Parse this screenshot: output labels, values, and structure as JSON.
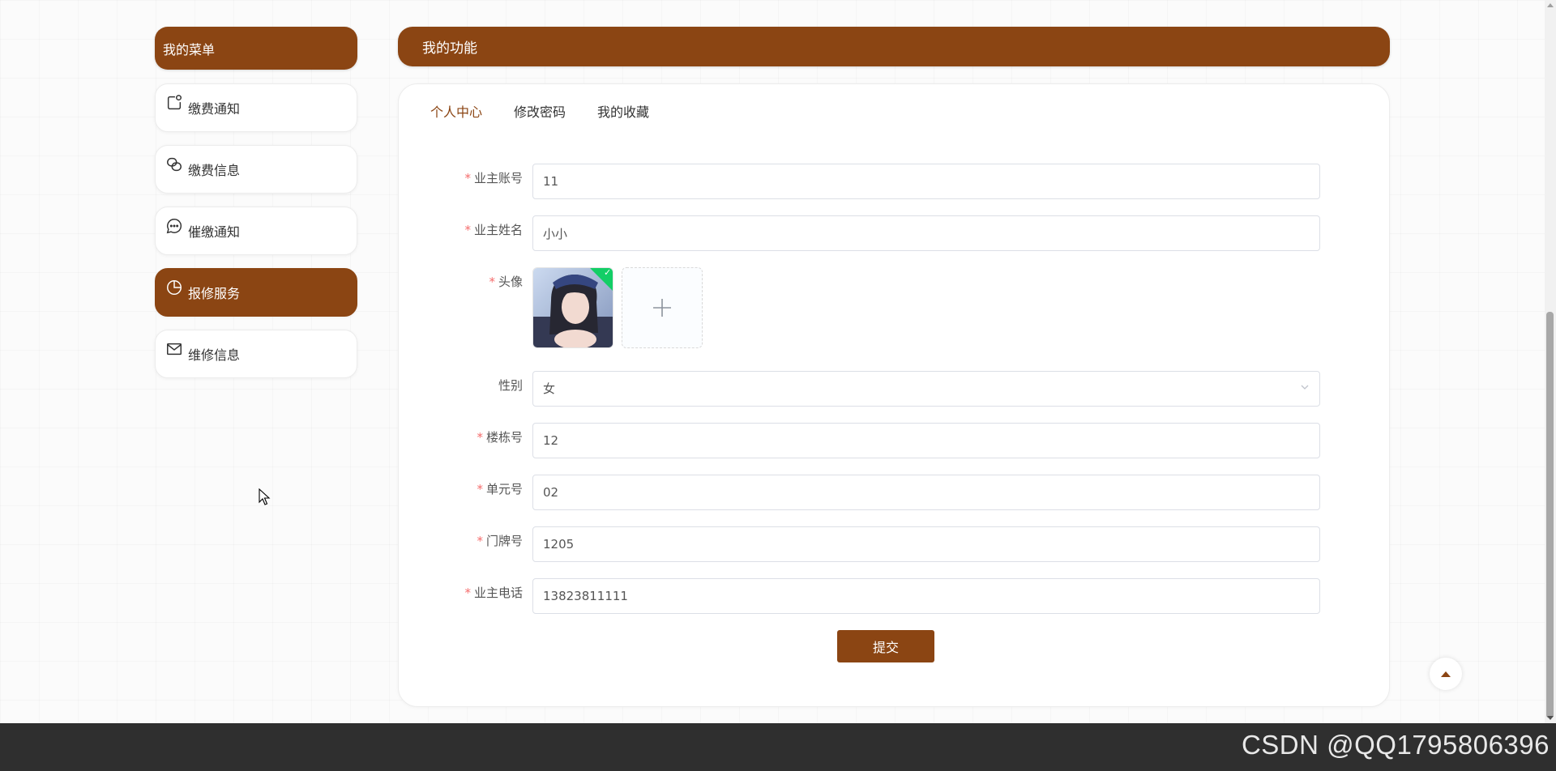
{
  "sidebar": {
    "title": "我的菜单",
    "items": [
      {
        "label": "缴费通知",
        "icon": "notification-icon"
      },
      {
        "label": "缴费信息",
        "icon": "link-icon"
      },
      {
        "label": "催缴通知",
        "icon": "chat-icon"
      },
      {
        "label": "报修服务",
        "icon": "pie-chart-icon",
        "active": true
      },
      {
        "label": "维修信息",
        "icon": "mail-icon"
      }
    ]
  },
  "main": {
    "title": "我的功能",
    "tabs": [
      {
        "label": "个人中心",
        "active": true
      },
      {
        "label": "修改密码"
      },
      {
        "label": "我的收藏"
      }
    ]
  },
  "form": {
    "account": {
      "label": "业主账号",
      "value": "11"
    },
    "name": {
      "label": "业主姓名",
      "value": "小小"
    },
    "avatar": {
      "label": "头像"
    },
    "gender": {
      "label": "性别",
      "value": "女"
    },
    "building": {
      "label": "楼栋号",
      "value": "12"
    },
    "unit": {
      "label": "单元号",
      "value": "02"
    },
    "door": {
      "label": "门牌号",
      "value": "1205"
    },
    "phone": {
      "label": "业主电话",
      "value": "13823811111"
    },
    "submit_label": "提交"
  },
  "watermark": "CSDN @QQ1795806396",
  "colors": {
    "brand": "#8b4513",
    "required": "#f56c6c"
  }
}
